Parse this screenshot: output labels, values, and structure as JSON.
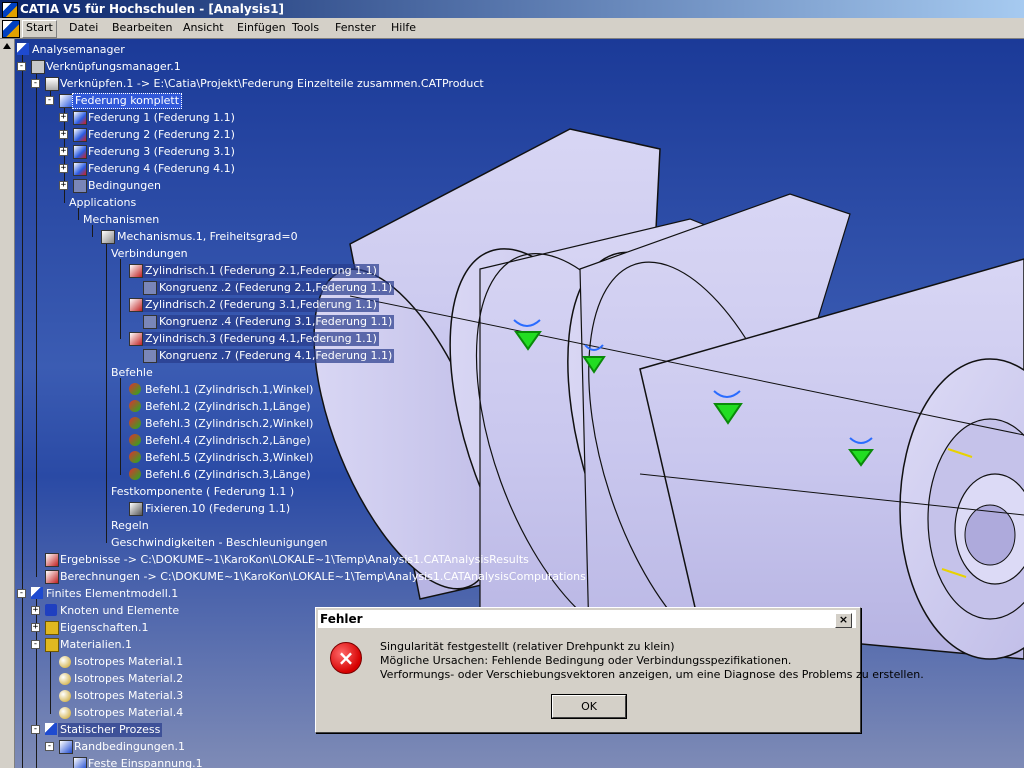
{
  "window": {
    "title": "CATIA V5 für Hochschulen - [Analysis1]"
  },
  "menu": [
    "Start",
    "Datei",
    "Bearbeiten",
    "Ansicht",
    "Einfügen",
    "Tools",
    "Fenster",
    "Hilfe"
  ],
  "tree": [
    {
      "label": "Analysemanager"
    },
    {
      "label": "Verknüpfungsmanager.1"
    },
    {
      "label": "Verknüpfen.1 -> E:\\Catia\\Projekt\\Federung Einzelteile zusammen.CATProduct"
    },
    {
      "label": "Federung komplett"
    },
    {
      "label": "Federung 1 (Federung 1.1)"
    },
    {
      "label": "Federung 2 (Federung 2.1)"
    },
    {
      "label": "Federung 3 (Federung 3.1)"
    },
    {
      "label": "Federung 4 (Federung 4.1)"
    },
    {
      "label": "Bedingungen"
    },
    {
      "label": "Applications"
    },
    {
      "label": "Mechanismen"
    },
    {
      "label": "Mechanismus.1, Freiheitsgrad=0"
    },
    {
      "label": "Verbindungen"
    },
    {
      "label": "Zylindrisch.1 (Federung 2.1,Federung 1.1)"
    },
    {
      "label": "Kongruenz .2 (Federung 2.1,Federung 1.1)"
    },
    {
      "label": "Zylindrisch.2 (Federung 3.1,Federung 1.1)"
    },
    {
      "label": "Kongruenz .4 (Federung 3.1,Federung 1.1)"
    },
    {
      "label": "Zylindrisch.3 (Federung 4.1,Federung 1.1)"
    },
    {
      "label": "Kongruenz .7 (Federung 4.1,Federung 1.1)"
    },
    {
      "label": "Befehle"
    },
    {
      "label": "Befehl.1 (Zylindrisch.1,Winkel)"
    },
    {
      "label": "Befehl.2 (Zylindrisch.1,Länge)"
    },
    {
      "label": "Befehl.3 (Zylindrisch.2,Winkel)"
    },
    {
      "label": "Befehl.4 (Zylindrisch.2,Länge)"
    },
    {
      "label": "Befehl.5 (Zylindrisch.3,Winkel)"
    },
    {
      "label": "Befehl.6 (Zylindrisch.3,Länge)"
    },
    {
      "label": "Festkomponente ( Federung 1.1 )"
    },
    {
      "label": "Fixieren.10 (Federung 1.1)"
    },
    {
      "label": "Regeln"
    },
    {
      "label": "Geschwindigkeiten - Beschleunigungen"
    },
    {
      "label": "Ergebnisse -> C:\\DOKUME~1\\KaroKon\\LOKALE~1\\Temp\\Analysis1.CATAnalysisResults"
    },
    {
      "label": "Berechnungen -> C:\\DOKUME~1\\KaroKon\\LOKALE~1\\Temp\\Analysis1.CATAnalysisComputations"
    },
    {
      "label": "Finites Elementmodell.1"
    },
    {
      "label": "Knoten und Elemente"
    },
    {
      "label": "Eigenschaften.1"
    },
    {
      "label": "Materialien.1"
    },
    {
      "label": "Isotropes Material.1"
    },
    {
      "label": "Isotropes Material.2"
    },
    {
      "label": "Isotropes Material.3"
    },
    {
      "label": "Isotropes Material.4"
    },
    {
      "label": "Statischer Prozess"
    },
    {
      "label": "Randbedingungen.1"
    },
    {
      "label": "Feste Einspannung.1"
    }
  ],
  "dialog": {
    "title": "Fehler",
    "line1": "Singularität festgestellt (relativer Drehpunkt zu klein)",
    "line2": "Mögliche Ursachen: Fehlende Bedingung oder Verbindungsspezifikationen.",
    "line3": "Verformungs- oder Verschiebungsvektoren anzeigen, um eine Diagnose des Problems zu erstellen.",
    "ok": "OK",
    "close": "×",
    "error_icon": "×"
  },
  "colors": {
    "title_bar": "#0a246a",
    "background": "#1b3a98",
    "part": "#cfcdf0",
    "marker": "#22dd22"
  }
}
